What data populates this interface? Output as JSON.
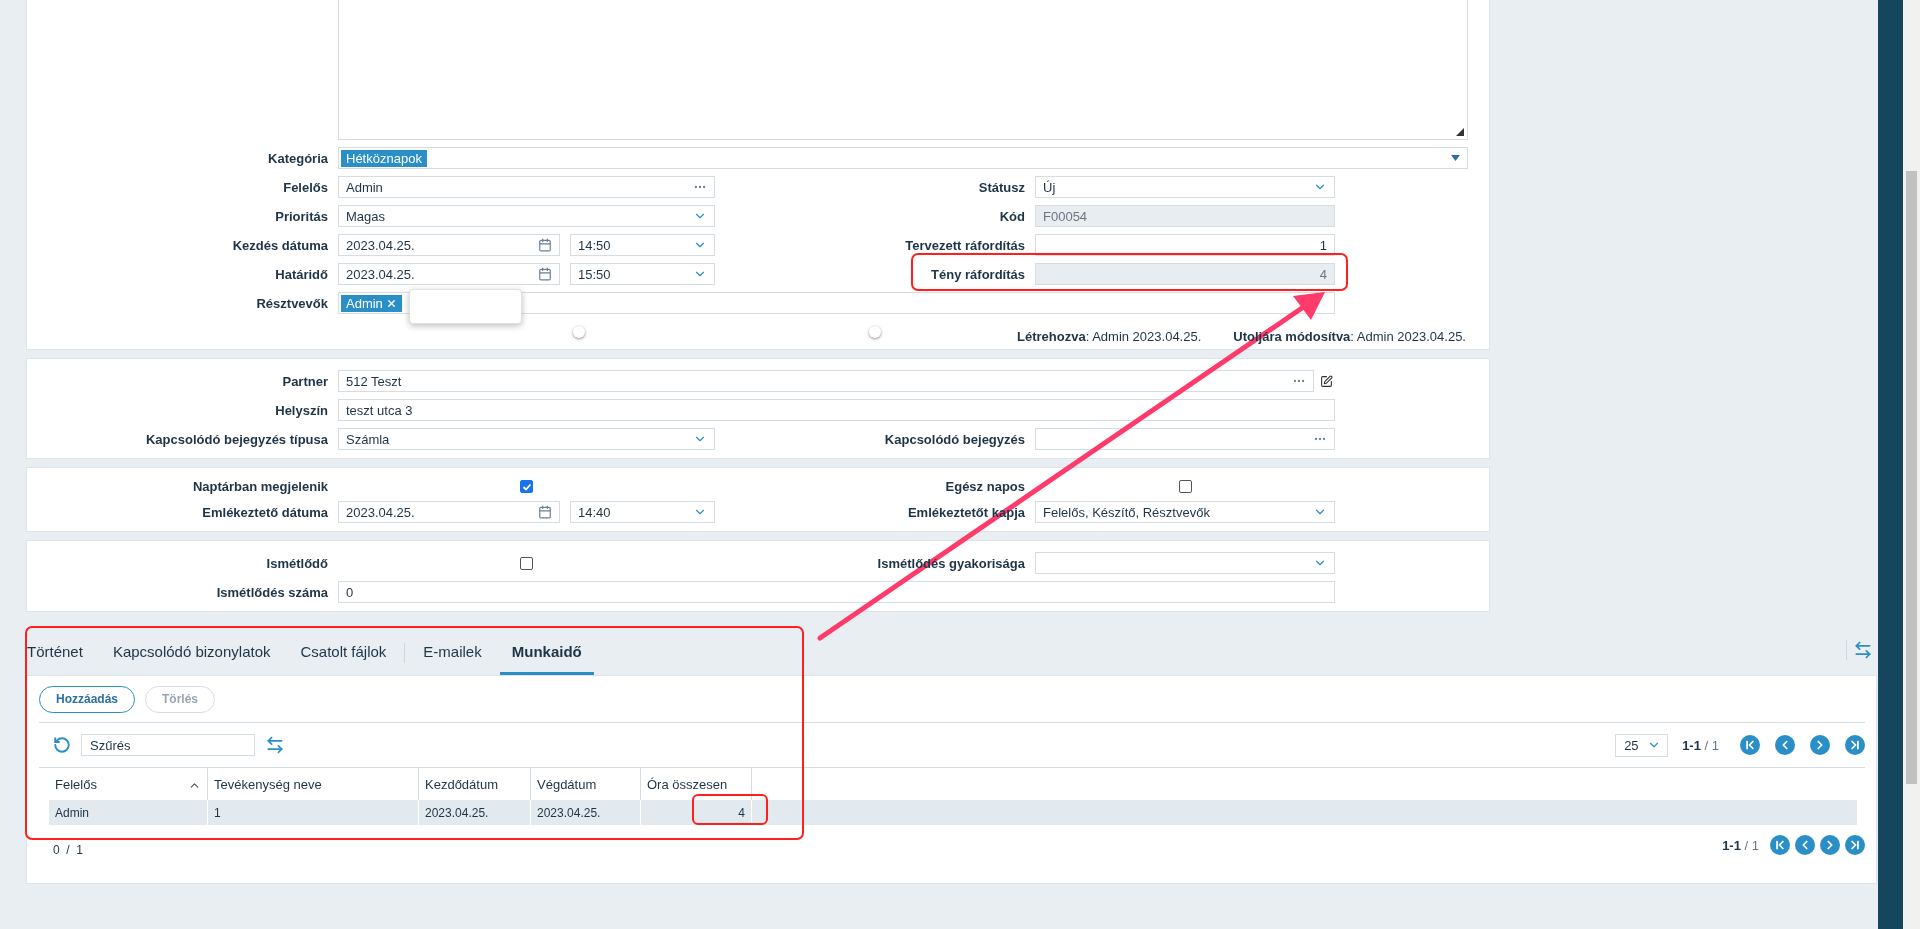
{
  "top_card": {
    "category": {
      "label": "Kategória",
      "tags": [
        "Hétköznapok"
      ]
    },
    "rows": [
      {
        "left": {
          "label": "Felelős",
          "kind": "lookup",
          "value": "Admin"
        },
        "right": {
          "label": "Státusz",
          "kind": "select",
          "value": "Új"
        }
      },
      {
        "left": {
          "label": "Prioritás",
          "kind": "select",
          "value": "Magas"
        },
        "right": {
          "label": "Kód",
          "kind": "readonly",
          "value": "F00054"
        }
      },
      {
        "left": {
          "label": "Kezdés dátuma",
          "kind": "datetime",
          "date": "2023.04.25.",
          "time": "14:50"
        },
        "right": {
          "label": "Tervezett ráfordítás",
          "kind": "number",
          "value": "1"
        }
      },
      {
        "left": {
          "label": "Határidő",
          "kind": "datetime",
          "date": "2023.04.25.",
          "time": "15:50"
        },
        "right": {
          "label": "Tény ráfordítás",
          "kind": "readonly-number",
          "value": "4"
        }
      },
      {
        "left": {
          "label": "Résztvevők",
          "kind": "tags",
          "tags": [
            "Admin"
          ],
          "open": true
        }
      }
    ],
    "meta": [
      "**Létrehozva**: Admin 2023.04.25.",
      "**Utoljára módosítva**: Admin 2023.04.25."
    ]
  },
  "cards": [
    {
      "rows": [
        {
          "left": {
            "label": "Partner",
            "kind": "lookup-edit",
            "value": "512 Teszt"
          }
        },
        {
          "left": {
            "label": "Helyszín",
            "kind": "text",
            "value": "teszt utca 3"
          }
        },
        {
          "left": {
            "label": "Kapcsolódó bejegyzés típusa",
            "kind": "select",
            "value": "Számla"
          },
          "right": {
            "label": "Kapcsolódó bejegyzés",
            "kind": "lookup"
          }
        }
      ]
    },
    {
      "rows": [
        {
          "left": {
            "label": "Naptárban megjelenik",
            "kind": "checkbox",
            "checked": true
          },
          "right": {
            "label": "Egész napos",
            "kind": "checkbox",
            "checked": false
          }
        },
        {
          "left": {
            "label": "Emlékeztető dátuma",
            "kind": "datetime",
            "date": "2023.04.25.",
            "time": "14:40"
          },
          "right": {
            "label": "Emlékeztetőt kapja",
            "kind": "select",
            "value": "Felelős, Készítő, Résztvevők"
          }
        }
      ]
    },
    {
      "rows": [
        {
          "left": {
            "label": "Ismétlődő",
            "kind": "checkbox",
            "checked": false
          },
          "right": {
            "label": "Ismétlődés gyakorisága",
            "kind": "select"
          }
        },
        {
          "left": {
            "label": "Ismétlődés száma",
            "kind": "text",
            "value": "0"
          }
        }
      ]
    }
  ],
  "tabs": [
    {
      "label": "Történet",
      "selected": false
    },
    {
      "label": "Kapcsolódó bizonylatok",
      "selected": false
    },
    {
      "label": "Csatolt fájlok",
      "selected": false
    },
    {
      "label": "E-mailek",
      "selected": false,
      "separator_before": true
    },
    {
      "label": "Munkaidő",
      "selected": true
    }
  ],
  "buttons": [
    {
      "label": "Hozzáadás",
      "disabled": false
    },
    {
      "label": "Törlés",
      "disabled": true
    }
  ],
  "filter": {
    "placeholder": "Szűrés"
  },
  "page_size": "25",
  "pager_top": "**1-1** / 1",
  "table": {
    "columns": [
      {
        "label": "Felelős",
        "sorted": true
      },
      {
        "label": "Tevékenység neve",
        "sorted": false
      },
      {
        "label": "Kezdődátum",
        "sorted": false
      },
      {
        "label": "Végdátum",
        "sorted": false
      },
      {
        "label": "Óra összesen",
        "sorted": false
      }
    ],
    "rows": [
      {
        "selected": true,
        "cells": [
          "Admin",
          "1",
          "2023.04.25.",
          "2023.04.25.",
          "4"
        ]
      }
    ]
  },
  "selection_count": "0  /  1",
  "pager_bottom": "**1-1** / 1"
}
